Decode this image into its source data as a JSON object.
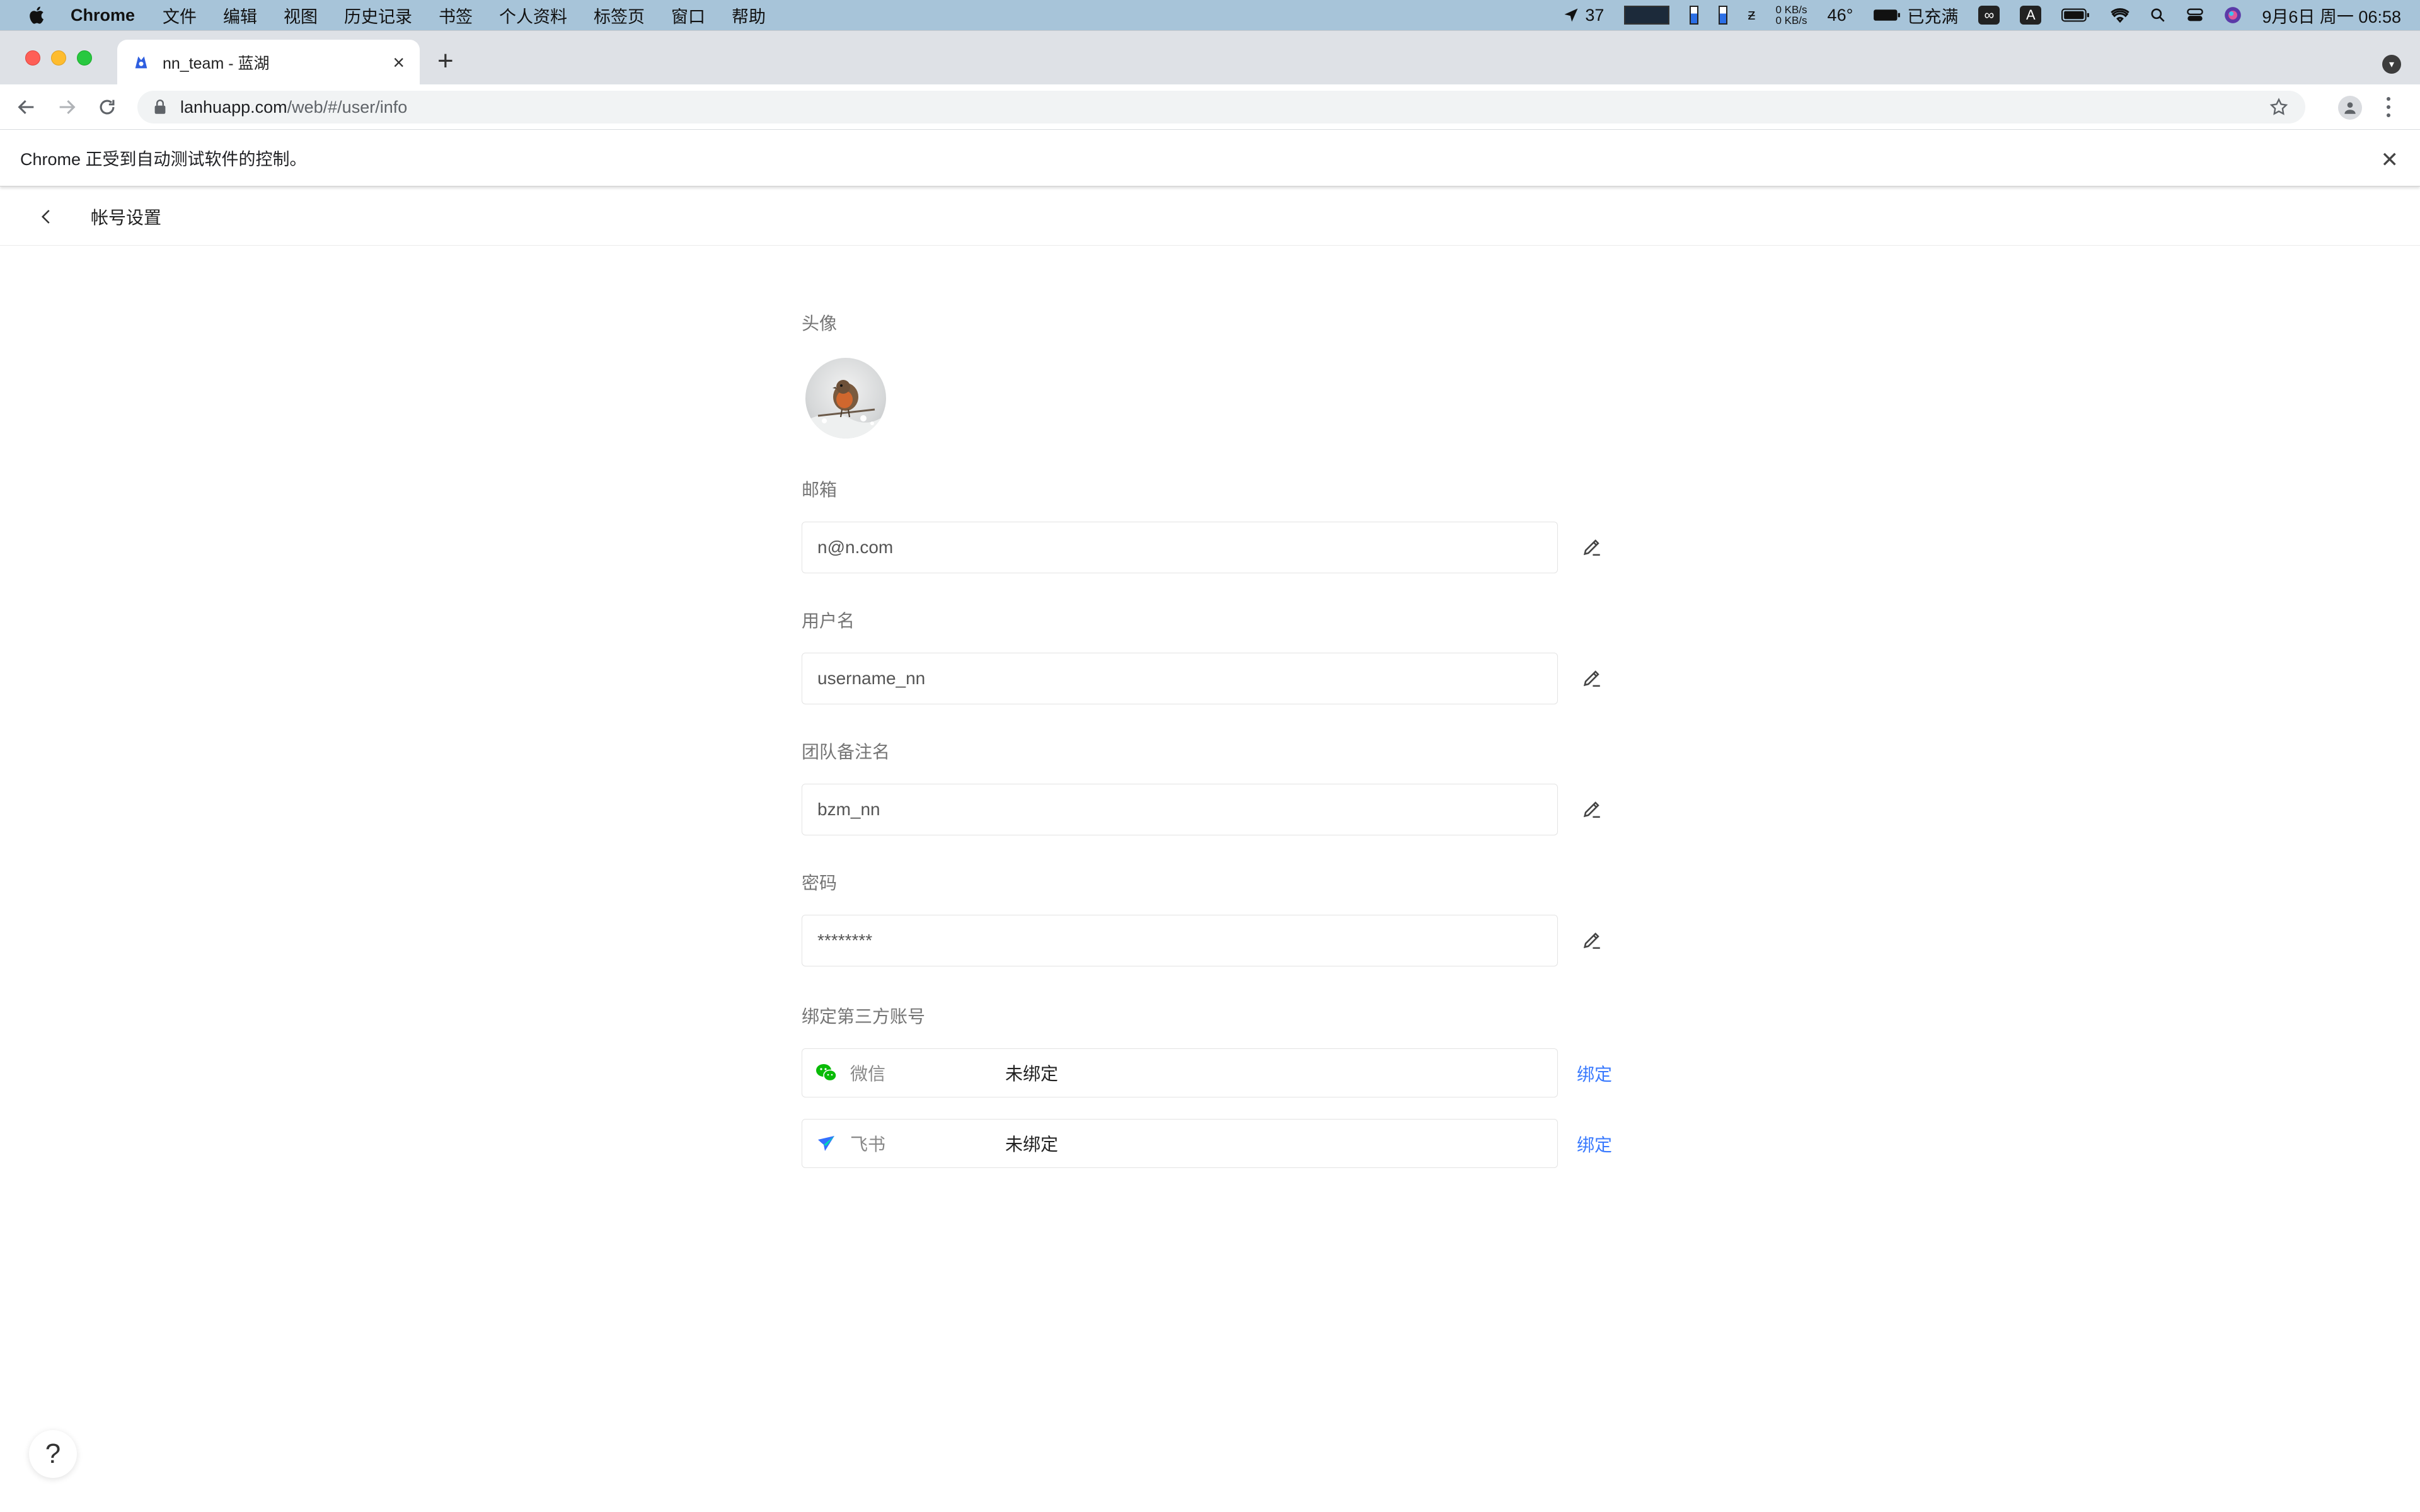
{
  "menubar": {
    "app_name": "Chrome",
    "menus": [
      "文件",
      "编辑",
      "视图",
      "历史记录",
      "书签",
      "个人资料",
      "标签页",
      "窗口",
      "帮助"
    ],
    "location_value": "37",
    "net_up": "0 KB/s",
    "net_down": "0 KB/s",
    "temperature": "46°",
    "battery_status": "已充满",
    "input_badge": "A",
    "datetime": "9月6日 周一  06:58"
  },
  "browser": {
    "tab_title": "nn_team - 蓝湖",
    "url_host": "lanhuapp.com",
    "url_path": "/web/#/user/info",
    "infobar_text": "Chrome 正受到自动测试软件的控制。"
  },
  "page": {
    "title": "帐号设置",
    "avatar_label": "头像",
    "email": {
      "label": "邮箱",
      "value": "n@n.com"
    },
    "username": {
      "label": "用户名",
      "value": "username_nn"
    },
    "team_alias": {
      "label": "团队备注名",
      "value": "bzm_nn"
    },
    "password": {
      "label": "密码",
      "value": "********"
    },
    "third_party": {
      "label": "绑定第三方账号",
      "accounts": [
        {
          "name": "微信",
          "status": "未绑定",
          "action": "绑定",
          "icon": "wechat-icon"
        },
        {
          "name": "飞书",
          "status": "未绑定",
          "action": "绑定",
          "icon": "feishu-icon"
        }
      ]
    },
    "help_label": "?"
  },
  "colors": {
    "accent": "#3a7afe",
    "menubar": "#a7c4d9",
    "wechat": "#09bb07",
    "feishu": "#3370ff"
  }
}
